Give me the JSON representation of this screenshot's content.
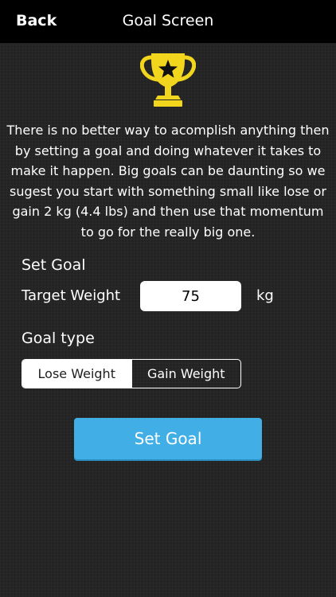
{
  "nav": {
    "back_label": "Back",
    "title": "Goal Screen"
  },
  "intro_text": "There is no better way to acomplish anything then by setting a goal and doing whatever it takes to make it happen. Big goals can be daunting so we sugest you start with something small like lose or gain 2 kg (4.4 lbs) and then use that momentum to go for the really big one.",
  "set_goal": {
    "heading": "Set Goal",
    "target_label": "Target Weight",
    "target_value": "75",
    "unit": "kg"
  },
  "goal_type": {
    "heading": "Goal type",
    "options": [
      {
        "label": "Lose Weight",
        "selected": true
      },
      {
        "label": "Gain Weight",
        "selected": false
      }
    ]
  },
  "submit_button_label": "Set Goal",
  "icons": {
    "trophy": "trophy-icon"
  },
  "colors": {
    "background": "#232323",
    "nav_bar": "#000000",
    "trophy": "#f2d51d",
    "button": "#41afe6"
  }
}
